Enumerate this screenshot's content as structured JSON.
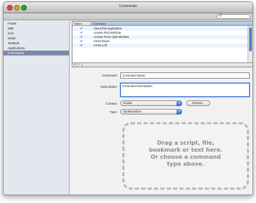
{
  "window": {
    "title": "Commands"
  },
  "sidebar": {
    "items": [
      {
        "label": "Finder",
        "selected": false
      },
      {
        "label": "Mail",
        "selected": false
      },
      {
        "label": "iCal",
        "selected": false
      },
      {
        "label": "Safari",
        "selected": false
      },
      {
        "label": "TextEdit",
        "selected": false
      },
      {
        "label": "Applications",
        "selected": false
      },
      {
        "label": "Commands",
        "selected": true
      }
    ]
  },
  "commands_table": {
    "columns": [
      "Status",
      "Command"
    ],
    "rows": [
      {
        "enabled": true,
        "command": "About this Application"
      },
      {
        "enabled": true,
        "command": "Access Find Window"
      },
      {
        "enabled": true,
        "command": "Access Force Quit Window"
      },
      {
        "enabled": true,
        "command": "Arrow Down"
      },
      {
        "enabled": true,
        "command": "Arrow Left"
      }
    ],
    "add_label": "+",
    "remove_label": "−"
  },
  "form": {
    "command_label": "Command:",
    "command_value": "Command Name",
    "description_label": "Description:",
    "description_value": "Command Description",
    "context_label": "Context:",
    "context_value": "Global",
    "choose_button": "Choose...",
    "type_label": "Type:",
    "type_value": "Spokenaction"
  },
  "drop_zone": {
    "text": "Drag a script, file,\nbookmark or text here.\nOr choose a command\ntype above."
  },
  "icons": {
    "search": "search-icon",
    "check": "checkmark-icon",
    "popup_arrows": "popup-arrows-icon"
  },
  "colors": {
    "selection": "#7a8aa7",
    "accent": "#2f63c7"
  }
}
